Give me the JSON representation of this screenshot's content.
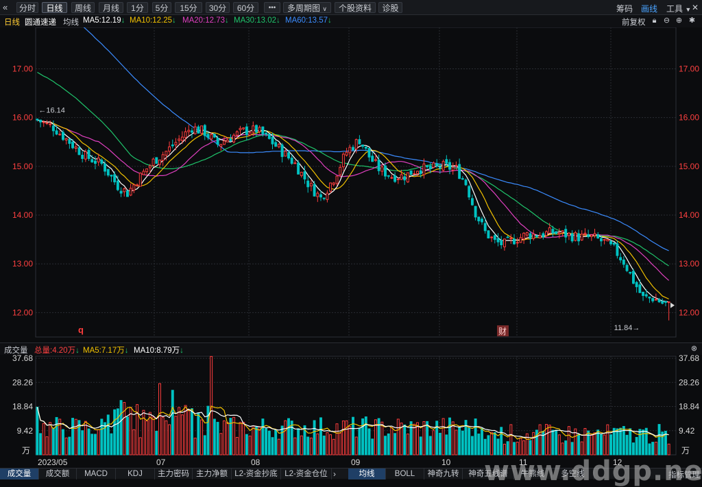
{
  "toolbar": {
    "back_icon": "double-chevron-left-icon",
    "periods": [
      "分时",
      "日线",
      "周线",
      "月线",
      "1分",
      "5分",
      "15分",
      "30分",
      "60分"
    ],
    "active_period": "日线",
    "more_label": "•••",
    "multi_period_label": "多周期图",
    "stock_info_label": "个股资料",
    "diagnose_label": "诊股",
    "chip_label": "筹码",
    "draw_label": "画线",
    "tools_label": "工具"
  },
  "ma_row": {
    "period_label": "日线",
    "stock_name": "圆通速递",
    "avg_label": "均线",
    "ma5": "MA5:12.19",
    "ma10": "MA10:12.25",
    "ma20": "MA20:12.73",
    "ma30": "MA30:13.02",
    "ma60": "MA60:13.57",
    "adjust_label": "前复权"
  },
  "colors": {
    "up": "#ff3d3d",
    "down": "#00c2c2",
    "ma5": "#ffffff",
    "ma10": "#f2c200",
    "ma20": "#e040c0",
    "ma30": "#1fc46b",
    "ma60": "#3b8cff",
    "price_label": "#ff4040",
    "vol_label": "#d8d8d8"
  },
  "chart_data": {
    "type": "candlestick",
    "price_ylim": [
      11.5,
      17.85
    ],
    "price_ticks": [
      "17.00",
      "16.00",
      "15.00",
      "14.00",
      "13.00",
      "12.00"
    ],
    "vol_ticks": [
      "37.68",
      "28.26",
      "18.84",
      "9.42"
    ],
    "vol_unit": "万",
    "vol_ylim": [
      0,
      38.5
    ],
    "x_labels": [
      "2023/05",
      "07",
      "08",
      "09",
      "10",
      "11",
      "12"
    ],
    "annotations": {
      "high_label": "←16.14",
      "low_label": "11.84→",
      "marker_q": "q",
      "marker_cai": "财"
    },
    "candles": [],
    "ma5": [],
    "ma10": [],
    "ma20": [],
    "ma30": [],
    "ma60": [],
    "volumes": [],
    "vol_ma5": [],
    "vol_ma10": []
  },
  "volume_row": {
    "title": "成交量",
    "total": "总量:4.20万",
    "ma5": "MA5:7.17万",
    "ma10": "MA10:8.79万"
  },
  "bottom_tabs": [
    "成交量",
    "成交额",
    "MACD",
    "KDJ",
    "主力密码",
    "主力净额",
    "L2-资金抄底",
    "L2-资金仓位"
  ],
  "bottom_tabs_right": [
    "均线",
    "BOLL",
    "神奇九转",
    "神奇五线谱",
    "牛熊线",
    "多空线"
  ],
  "indicator_manage": "指标管理",
  "watermark": "www.ddgp.net"
}
